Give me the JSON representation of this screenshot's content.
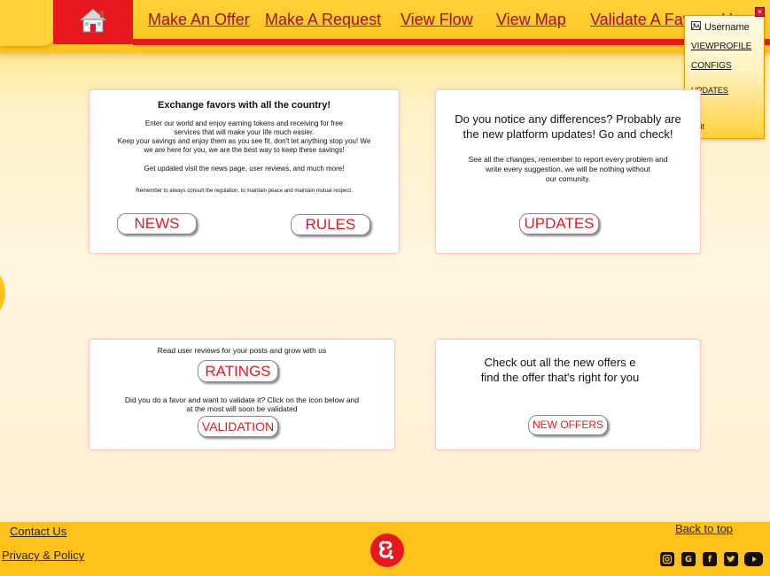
{
  "nav": {
    "links": [
      "Make An Offer",
      "Make A Request",
      "View Flow",
      "View Map",
      "Validate A Favor",
      "H"
    ]
  },
  "user_menu": {
    "username": "Username",
    "items": [
      "VIEWPROFILE",
      "CONFIGS",
      "UPDATES",
      "Exit"
    ]
  },
  "card1": {
    "title": "Exchange favors with all the country!",
    "line1": "Enter our world and enjoy earning tokens and receiving for free",
    "line2": "services that will make your life much easier.",
    "line3": "Keep your savings and enjoy them as you see fit, don't let anything stop you! We",
    "line4": "we are here for you, we are the best way to keep these savings!",
    "line5": "Get updated visit the news page, user reviews, and much more!",
    "line6": "Remember to always consult the regulation, to maintain peace and maintain mutual respect.",
    "btn_news": "NEWS",
    "btn_rules": "RULES"
  },
  "card2": {
    "line1": "Do you notice any differences? Probably are",
    "line2": "the new platform updates! Go and check!",
    "line3": "See all the changes, remember to report every problem and",
    "line4": "write every suggestion, we will be nothing without",
    "line5": "our comunity.",
    "btn_updates": "UPDATES"
  },
  "card3": {
    "line1": "Read user reviews for your posts and grow with us",
    "btn_ratings": "RATINGS",
    "line2": "Did you do a favor and want to validate it? Click on the icon below and",
    "line3": "at the most will soon be validated",
    "btn_validation": "VALIDATION"
  },
  "card4": {
    "line1": "Check out all the new offers e",
    "line2": "find the offer that's right for you",
    "btn_new_offers": "NEW OFFERS"
  },
  "footer": {
    "contact": "Contact Us",
    "privacy": "Privacy & Policy",
    "back_to_top": "Back to top",
    "social_icons": [
      "instagram-icon",
      "google-icon",
      "facebook-icon",
      "twitter-icon",
      "youtube-icon"
    ]
  },
  "colors": {
    "accent_red": "#e8171e",
    "brand_yellow": "#ffc21a"
  }
}
